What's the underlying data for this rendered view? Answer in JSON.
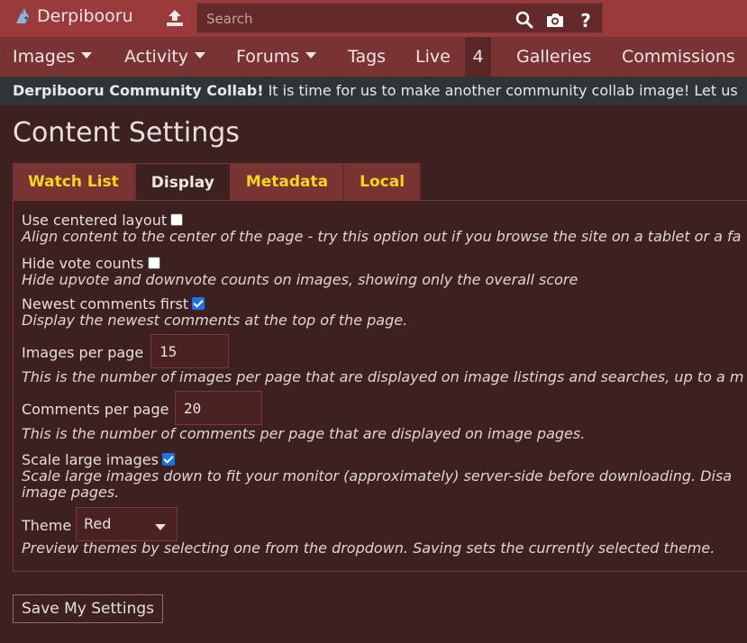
{
  "header": {
    "site_name": "Derpibooru",
    "search_placeholder": "Search",
    "icons": [
      "logo-icon",
      "upload-icon",
      "search-icon",
      "camera-icon",
      "help-icon"
    ]
  },
  "nav": {
    "images": "Images",
    "activity": "Activity",
    "forums": "Forums",
    "tags": "Tags",
    "live": "Live",
    "live_count": "4",
    "galleries": "Galleries",
    "commissions": "Commissions"
  },
  "notice": {
    "title": "Derpibooru Community Collab!",
    "text": " It is time for us to make another community collab image! Let us"
  },
  "page": {
    "title": "Content Settings",
    "tabs": [
      "Watch List",
      "Display",
      "Metadata",
      "Local"
    ],
    "active_tab": "Display"
  },
  "settings": {
    "centered_label": "Use centered layout",
    "centered_help": "Align content to the center of the page - try this option out if you browse the site on a tablet or a fa",
    "centered_checked": false,
    "vote_label": "Hide vote counts",
    "vote_help": "Hide upvote and downvote counts on images, showing only the overall score",
    "vote_checked": false,
    "newest_label": "Newest comments first",
    "newest_help": "Display the newest comments at the top of the page.",
    "newest_checked": true,
    "ipp_label": "Images per page",
    "ipp_value": "15",
    "ipp_help": "This is the number of images per page that are displayed on image listings and searches, up to a m",
    "cpp_label": "Comments per page",
    "cpp_value": "20",
    "cpp_help": "This is the number of comments per page that are displayed on image pages.",
    "scale_label": "Scale large images",
    "scale_help_1": "Scale large images down to fit your monitor (approximately) server-side before downloading. Disa",
    "scale_help_2": "image pages.",
    "scale_checked": true,
    "theme_label": "Theme",
    "theme_value": "Red",
    "theme_help": "Preview themes by selecting one from the dropdown. Saving sets the currently selected theme."
  },
  "save_button": "Save My Settings",
  "colors": {
    "header": "#9b3a3a",
    "nav": "#7a3333",
    "background": "#3d2020",
    "notice": "#2f3438",
    "tab_text": "#f0d81c",
    "checkbox_on": "#1a73e8"
  }
}
